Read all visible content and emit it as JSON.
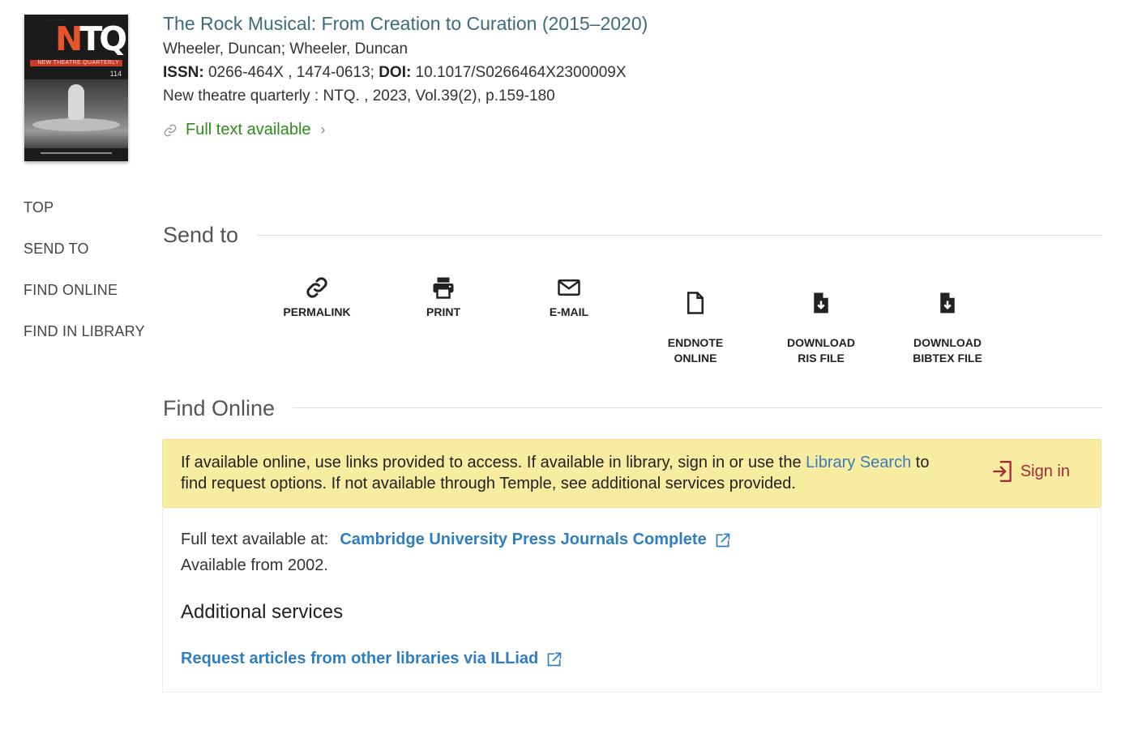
{
  "cover": {
    "logo_text": "NTQ",
    "strip_text": "NEW THEATRE QUARTERLY",
    "issue_number": "114"
  },
  "record": {
    "title": "The Rock Musical: From Creation to Curation (2015–2020)",
    "authors": "Wheeler, Duncan; Wheeler, Duncan",
    "issn_label": "ISSN:",
    "issn_value": "0266-464X , 1474-0613;",
    "doi_label": "DOI:",
    "doi_value": "10.1017/S0266464X2300009X",
    "source": "New theatre quarterly : NTQ. , 2023, Vol.39(2), p.159-180",
    "availability": "Full text available"
  },
  "nav": {
    "items": [
      "TOP",
      "SEND TO",
      "FIND ONLINE",
      "FIND IN LIBRARY"
    ]
  },
  "send_to": {
    "title": "Send to",
    "actions": [
      {
        "label": "PERMALINK",
        "icon": "link-icon"
      },
      {
        "label": "PRINT",
        "icon": "printer-icon"
      },
      {
        "label": "E-MAIL",
        "icon": "envelope-icon"
      },
      {
        "label": "ENDNOTE\nONLINE",
        "icon": "document-icon"
      },
      {
        "label": "DOWNLOAD\nRIS FILE",
        "icon": "file-download-icon"
      },
      {
        "label": "DOWNLOAD\nBIBTEX FILE",
        "icon": "file-download-icon"
      }
    ]
  },
  "find_online": {
    "title": "Find Online",
    "notice_before": "If available online, use links provided to access. If available in library, sign in or use the ",
    "notice_link": "Library Search",
    "notice_after": " to find request options. If not available through Temple, see additional services provided.",
    "sign_in": "Sign in",
    "full_text_label": "Full text available at:",
    "provider": "Cambridge University Press Journals Complete",
    "available_from": "Available from 2002.",
    "additional_title": "Additional services",
    "illiad_link": "Request articles from other libraries via ILLiad"
  },
  "colors": {
    "title_link": "#3d6b7d",
    "availability_green": "#2f8a1d",
    "link_blue": "#2f7ebf",
    "notice_bg": "#f7ec9f",
    "sign_in_red": "#a82a3a"
  }
}
